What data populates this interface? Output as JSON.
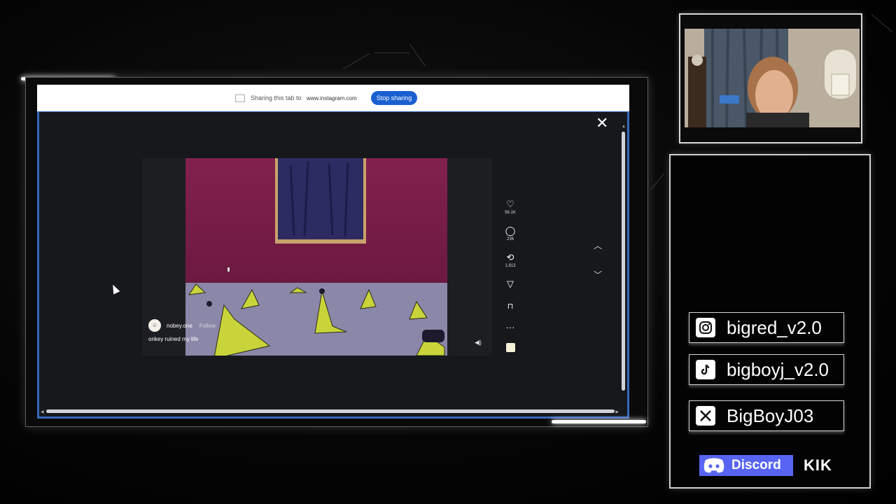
{
  "share_bar": {
    "text": "Sharing this tab to",
    "url": "www.instagram.com",
    "stop_label": "Stop sharing"
  },
  "post": {
    "username": "nobey.one",
    "follow_label": "Follow",
    "caption": "onkey ruined my life",
    "like_count": "56.1K",
    "comment_count": "236",
    "repost_count": "1,813",
    "icons": {
      "like": "heart-icon",
      "comment": "comment-icon",
      "repost": "repost-icon",
      "share": "send-icon",
      "save": "bookmark-icon",
      "more": "more-icon",
      "mute": "volume-icon",
      "close": "close-icon",
      "prev": "chevron-up-icon",
      "next": "chevron-down-icon"
    }
  },
  "socials": {
    "instagram": "bigred_v2.0",
    "tiktok": "bigboyj_v2.0",
    "x": "BigBoyJ03",
    "discord": "Discord",
    "kik": "KIK"
  },
  "colors": {
    "stop_button": "#1a5fd1",
    "page_border": "#3867bd",
    "discord": "#5865f2",
    "video_wall": "#7a1d4a",
    "video_floor": "#8b87a8",
    "banana": "#c8d43a"
  }
}
